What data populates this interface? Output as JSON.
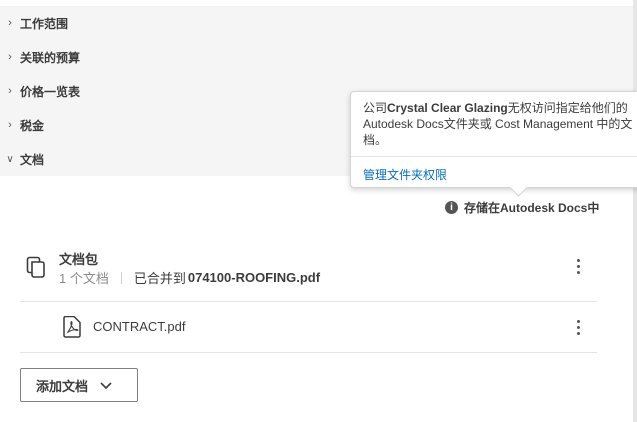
{
  "sections": [
    {
      "label": "工作范围",
      "expanded": false
    },
    {
      "label": "关联的预算",
      "expanded": false
    },
    {
      "label": "价格一览表",
      "expanded": false
    },
    {
      "label": "税金",
      "expanded": false
    },
    {
      "label": "文档",
      "expanded": true
    }
  ],
  "tooltip": {
    "prefix": "公司",
    "company": "Crystal Clear Glazing",
    "message": "无权访问指定给他们的 Autodesk Docs文件夹或 Cost Management 中的文档。",
    "link": "管理文件夹权限"
  },
  "storage": {
    "label": "存储在Autodesk Docs中",
    "icon": "info-icon"
  },
  "package": {
    "title": "文档包",
    "count": "1 个文档",
    "merged_prefix": "已合并到",
    "merged_file": "074100-ROOFING.pdf",
    "icon": "copy-icon"
  },
  "file": {
    "name": "CONTRACT.pdf",
    "icon": "pdf-icon"
  },
  "add_button": {
    "label": "添加文档"
  },
  "colors": {
    "link": "#0a6fb8",
    "section_bg": "#f5f5f5",
    "text": "#3c3c3c"
  }
}
